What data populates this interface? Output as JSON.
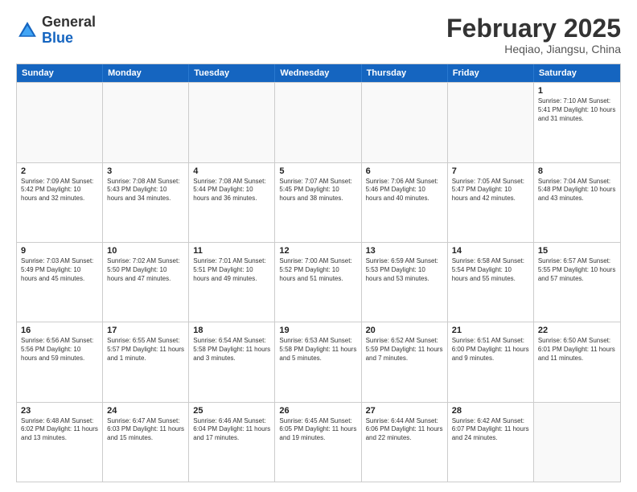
{
  "header": {
    "logo_general": "General",
    "logo_blue": "Blue",
    "month_title": "February 2025",
    "location": "Heqiao, Jiangsu, China"
  },
  "days_of_week": [
    "Sunday",
    "Monday",
    "Tuesday",
    "Wednesday",
    "Thursday",
    "Friday",
    "Saturday"
  ],
  "rows": [
    [
      {
        "day": "",
        "text": "",
        "empty": true
      },
      {
        "day": "",
        "text": "",
        "empty": true
      },
      {
        "day": "",
        "text": "",
        "empty": true
      },
      {
        "day": "",
        "text": "",
        "empty": true
      },
      {
        "day": "",
        "text": "",
        "empty": true
      },
      {
        "day": "",
        "text": "",
        "empty": true
      },
      {
        "day": "1",
        "text": "Sunrise: 7:10 AM\nSunset: 5:41 PM\nDaylight: 10 hours and 31 minutes.",
        "empty": false
      }
    ],
    [
      {
        "day": "2",
        "text": "Sunrise: 7:09 AM\nSunset: 5:42 PM\nDaylight: 10 hours and 32 minutes.",
        "empty": false
      },
      {
        "day": "3",
        "text": "Sunrise: 7:08 AM\nSunset: 5:43 PM\nDaylight: 10 hours and 34 minutes.",
        "empty": false
      },
      {
        "day": "4",
        "text": "Sunrise: 7:08 AM\nSunset: 5:44 PM\nDaylight: 10 hours and 36 minutes.",
        "empty": false
      },
      {
        "day": "5",
        "text": "Sunrise: 7:07 AM\nSunset: 5:45 PM\nDaylight: 10 hours and 38 minutes.",
        "empty": false
      },
      {
        "day": "6",
        "text": "Sunrise: 7:06 AM\nSunset: 5:46 PM\nDaylight: 10 hours and 40 minutes.",
        "empty": false
      },
      {
        "day": "7",
        "text": "Sunrise: 7:05 AM\nSunset: 5:47 PM\nDaylight: 10 hours and 42 minutes.",
        "empty": false
      },
      {
        "day": "8",
        "text": "Sunrise: 7:04 AM\nSunset: 5:48 PM\nDaylight: 10 hours and 43 minutes.",
        "empty": false
      }
    ],
    [
      {
        "day": "9",
        "text": "Sunrise: 7:03 AM\nSunset: 5:49 PM\nDaylight: 10 hours and 45 minutes.",
        "empty": false
      },
      {
        "day": "10",
        "text": "Sunrise: 7:02 AM\nSunset: 5:50 PM\nDaylight: 10 hours and 47 minutes.",
        "empty": false
      },
      {
        "day": "11",
        "text": "Sunrise: 7:01 AM\nSunset: 5:51 PM\nDaylight: 10 hours and 49 minutes.",
        "empty": false
      },
      {
        "day": "12",
        "text": "Sunrise: 7:00 AM\nSunset: 5:52 PM\nDaylight: 10 hours and 51 minutes.",
        "empty": false
      },
      {
        "day": "13",
        "text": "Sunrise: 6:59 AM\nSunset: 5:53 PM\nDaylight: 10 hours and 53 minutes.",
        "empty": false
      },
      {
        "day": "14",
        "text": "Sunrise: 6:58 AM\nSunset: 5:54 PM\nDaylight: 10 hours and 55 minutes.",
        "empty": false
      },
      {
        "day": "15",
        "text": "Sunrise: 6:57 AM\nSunset: 5:55 PM\nDaylight: 10 hours and 57 minutes.",
        "empty": false
      }
    ],
    [
      {
        "day": "16",
        "text": "Sunrise: 6:56 AM\nSunset: 5:56 PM\nDaylight: 10 hours and 59 minutes.",
        "empty": false
      },
      {
        "day": "17",
        "text": "Sunrise: 6:55 AM\nSunset: 5:57 PM\nDaylight: 11 hours and 1 minute.",
        "empty": false
      },
      {
        "day": "18",
        "text": "Sunrise: 6:54 AM\nSunset: 5:58 PM\nDaylight: 11 hours and 3 minutes.",
        "empty": false
      },
      {
        "day": "19",
        "text": "Sunrise: 6:53 AM\nSunset: 5:58 PM\nDaylight: 11 hours and 5 minutes.",
        "empty": false
      },
      {
        "day": "20",
        "text": "Sunrise: 6:52 AM\nSunset: 5:59 PM\nDaylight: 11 hours and 7 minutes.",
        "empty": false
      },
      {
        "day": "21",
        "text": "Sunrise: 6:51 AM\nSunset: 6:00 PM\nDaylight: 11 hours and 9 minutes.",
        "empty": false
      },
      {
        "day": "22",
        "text": "Sunrise: 6:50 AM\nSunset: 6:01 PM\nDaylight: 11 hours and 11 minutes.",
        "empty": false
      }
    ],
    [
      {
        "day": "23",
        "text": "Sunrise: 6:48 AM\nSunset: 6:02 PM\nDaylight: 11 hours and 13 minutes.",
        "empty": false
      },
      {
        "day": "24",
        "text": "Sunrise: 6:47 AM\nSunset: 6:03 PM\nDaylight: 11 hours and 15 minutes.",
        "empty": false
      },
      {
        "day": "25",
        "text": "Sunrise: 6:46 AM\nSunset: 6:04 PM\nDaylight: 11 hours and 17 minutes.",
        "empty": false
      },
      {
        "day": "26",
        "text": "Sunrise: 6:45 AM\nSunset: 6:05 PM\nDaylight: 11 hours and 19 minutes.",
        "empty": false
      },
      {
        "day": "27",
        "text": "Sunrise: 6:44 AM\nSunset: 6:06 PM\nDaylight: 11 hours and 22 minutes.",
        "empty": false
      },
      {
        "day": "28",
        "text": "Sunrise: 6:42 AM\nSunset: 6:07 PM\nDaylight: 11 hours and 24 minutes.",
        "empty": false
      },
      {
        "day": "",
        "text": "",
        "empty": true
      }
    ]
  ]
}
